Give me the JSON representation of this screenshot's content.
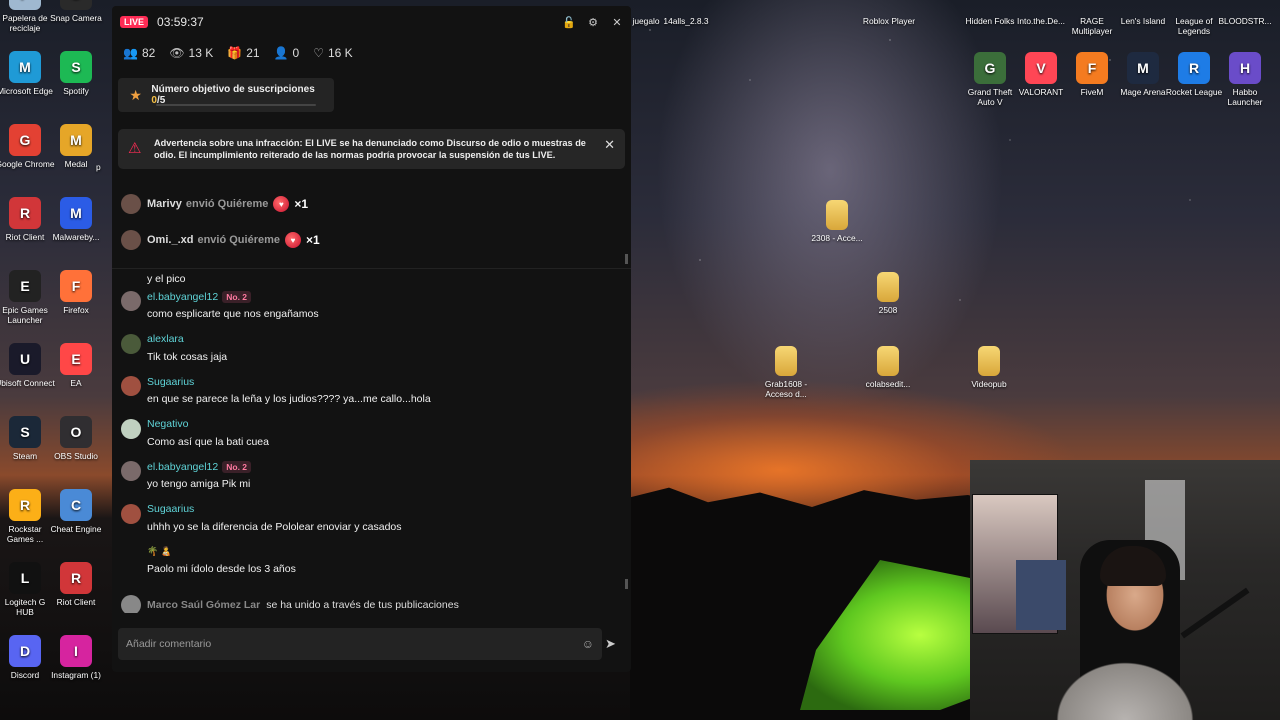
{
  "desktop": {
    "left_icons": [
      {
        "label": "Papelera de reciclaje",
        "icon": "recycle-bin-icon",
        "color": "#9fb8d0"
      },
      {
        "label": "Snap Camera",
        "icon": "snap-camera-icon",
        "color": "#2a2a2a"
      },
      {
        "label": "Microsoft Edge",
        "icon": "edge-icon",
        "color": "#1f9ad6"
      },
      {
        "label": "Spotify",
        "icon": "spotify-icon",
        "color": "#1db954"
      },
      {
        "label": "Google Chrome",
        "icon": "chrome-icon",
        "color": "#e34133"
      },
      {
        "label": "Medal",
        "icon": "medal-icon",
        "color": "#e6a628"
      },
      {
        "label": "Riot Client",
        "icon": "riot-icon",
        "color": "#d13639"
      },
      {
        "label": "Malwareby...",
        "icon": "malwarebytes-icon",
        "color": "#2b5ce6"
      },
      {
        "label": "Epic Games Launcher",
        "icon": "epic-games-icon",
        "color": "#222222"
      },
      {
        "label": "Firefox",
        "icon": "firefox-icon",
        "color": "#ff7139"
      },
      {
        "label": "Ubisoft Connect",
        "icon": "ubisoft-icon",
        "color": "#1a1a2a"
      },
      {
        "label": "EA",
        "icon": "ea-icon",
        "color": "#ff4747"
      },
      {
        "label": "Steam",
        "icon": "steam-icon",
        "color": "#1b2838"
      },
      {
        "label": "OBS Studio",
        "icon": "obs-icon",
        "color": "#302e31"
      },
      {
        "label": "Rockstar Games ...",
        "icon": "rockstar-icon",
        "color": "#fcaf17"
      },
      {
        "label": "Cheat Engine",
        "icon": "cheat-engine-icon",
        "color": "#4a8ad6"
      },
      {
        "label": "Logitech G HUB",
        "icon": "logitech-icon",
        "color": "#111111"
      },
      {
        "label": "Riot Client",
        "icon": "riot-icon",
        "color": "#d13639"
      },
      {
        "label": "Discord",
        "icon": "discord-icon",
        "color": "#5865f2"
      },
      {
        "label": "Instagram (1)",
        "icon": "instagram-icon",
        "color": "#d6249f"
      }
    ],
    "partial_label": "p",
    "top_icons": [
      {
        "label": "juegalo"
      },
      {
        "label": "14alls_2.8.3"
      },
      {
        "label": "Roblox Player"
      },
      {
        "label": "Hidden Folks"
      },
      {
        "label": "Into.the.De..."
      },
      {
        "label": "RAGE Multiplayer"
      },
      {
        "label": "Len's Island"
      },
      {
        "label": "League of Legends"
      },
      {
        "label": "BLOODSTR..."
      }
    ],
    "row2_icons": [
      {
        "label": "Grand Theft Auto V",
        "icon": "gta-icon",
        "color": "#3b6e3a"
      },
      {
        "label": "VALORANT",
        "icon": "valorant-icon",
        "color": "#ff4655"
      },
      {
        "label": "FiveM",
        "icon": "fivem-icon",
        "color": "#f47b20"
      },
      {
        "label": "Mage Arena",
        "icon": "mage-arena-icon",
        "color": "#1e2a40"
      },
      {
        "label": "Rocket League",
        "icon": "rocket-league-icon",
        "color": "#1e7ce6"
      },
      {
        "label": "Habbo Launcher",
        "icon": "habbo-icon",
        "color": "#6a4cc9"
      }
    ],
    "folders": [
      {
        "label": "2308 - Acce..."
      },
      {
        "label": "2508"
      },
      {
        "label": "Grab1608 - Acceso d..."
      },
      {
        "label": "colabsedit..."
      },
      {
        "label": "Videopub"
      }
    ]
  },
  "live": {
    "badge": "LIVE",
    "timer": "03:59:37",
    "stats": [
      {
        "icon": "users-icon",
        "glyph": "👥",
        "value": "82"
      },
      {
        "icon": "eye-icon",
        "glyph": "👁",
        "value": "13 K"
      },
      {
        "icon": "gift-icon",
        "glyph": "🎁",
        "value": "21"
      },
      {
        "icon": "follow-icon",
        "glyph": "👤",
        "value": "0"
      },
      {
        "icon": "heart-icon",
        "glyph": "♡",
        "value": "16 K"
      }
    ],
    "goal": {
      "label": "Número objetivo de suscripciones",
      "current": "0",
      "total": "/5"
    },
    "warning": "Advertencia sobre una infracción: El LIVE se ha denunciado como Discurso de odio o muestras de odio. El incumplimiento reiterado de las normas podría provocar la suspensión de tus LIVE.",
    "gifts": [
      {
        "name": "Marivy",
        "action": "envió Quiéreme",
        "count": "×1"
      },
      {
        "name": "Omi._.xd",
        "action": "envió Quiéreme",
        "count": "×1"
      }
    ],
    "cut_text": "y el pico",
    "messages": [
      {
        "user": "el.babyangel12",
        "rank": "No. 2",
        "text": "como esplicarte que nos engañamos"
      },
      {
        "user": "alexlara",
        "rank": "",
        "text": "Tik tok cosas jaja"
      },
      {
        "user": "Sugaarius",
        "rank": "",
        "text": "en que se parece la leña y los judios???? ya...me callo...hola"
      },
      {
        "user": "Negativo",
        "rank": "",
        "text": "Como así que la bati cuea"
      },
      {
        "user": "el.babyangel12",
        "rank": "No. 2",
        "text": "yo tengo amiga Pik mi"
      },
      {
        "user": "Sugaarius",
        "rank": "",
        "text": "uhhh yo se la diferencia de Pololear enoviar y casados"
      },
      {
        "user": "🌴 🧑‍🍼",
        "rank": "",
        "text": "Paolo mi ídolo desde los 3 años"
      }
    ],
    "join": {
      "name": "Marco Saúl Gómez Lar",
      "text": "se ha unido a través de tus publicaciones"
    },
    "comment_placeholder": "Añadir comentario"
  }
}
